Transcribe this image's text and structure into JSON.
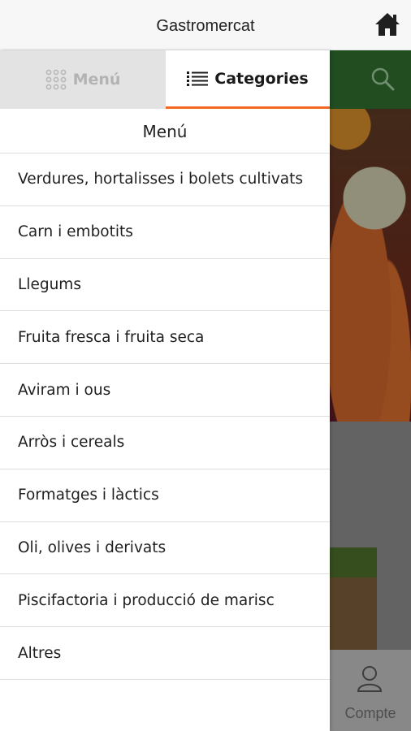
{
  "header": {
    "title": "Gastromercat",
    "home_icon": "home-icon"
  },
  "drawer": {
    "tabs": [
      {
        "label": "Menú",
        "icon": "grid-icon",
        "active": false
      },
      {
        "label": "Categories",
        "icon": "list-icon",
        "active": true
      }
    ],
    "section_title": "Menú",
    "items": [
      "Verdures, hortalisses i bolets cultivats",
      "Carn i embotits",
      "Llegums",
      "Fruita fresca i fruita seca",
      "Aviram i ous",
      "Arròs i cereals",
      "Formatges i làctics",
      "Oli, olives i derivats",
      "Piscifactoria i producció de marisc",
      "Altres"
    ]
  },
  "background": {
    "search_icon": "search-icon",
    "bottom_nav": {
      "label": "Compte",
      "icon": "user-icon"
    }
  },
  "colors": {
    "accent": "#f26722",
    "header_green": "#2f6b2f"
  }
}
